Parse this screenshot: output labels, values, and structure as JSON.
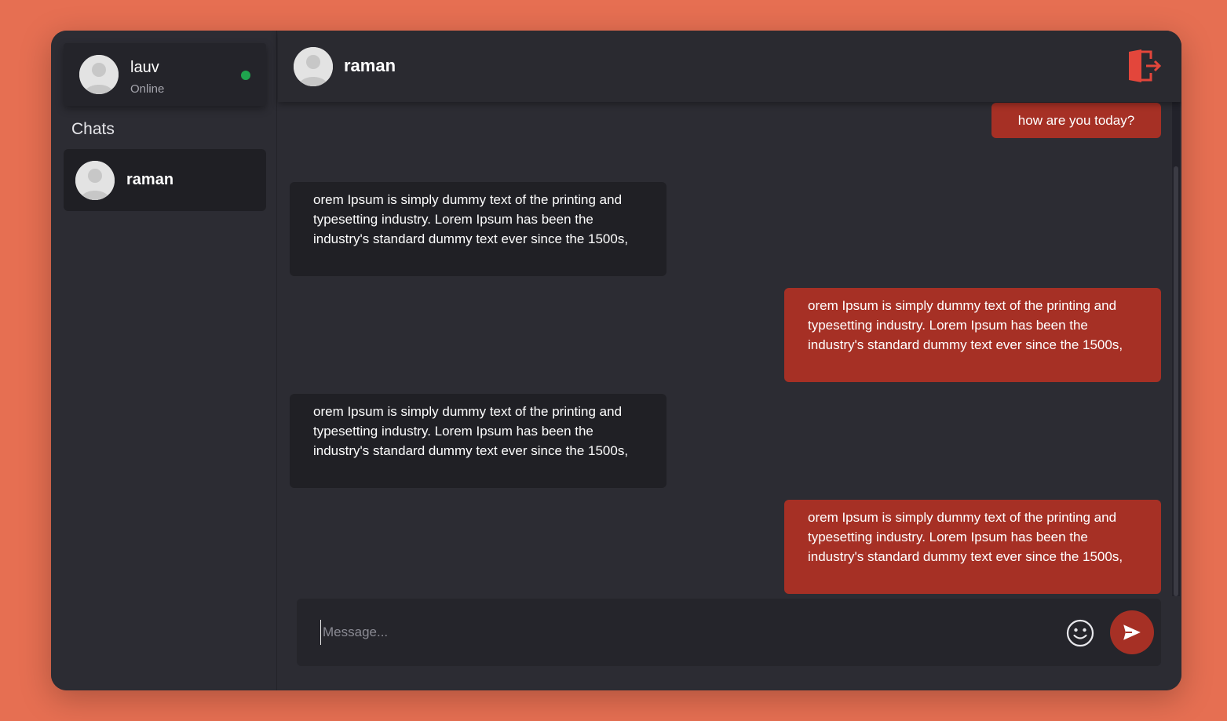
{
  "current_user": {
    "name": "lauv",
    "status": "Online"
  },
  "sidebar": {
    "heading": "Chats",
    "chats": [
      {
        "name": "raman"
      }
    ]
  },
  "conversation": {
    "contact_name": "raman",
    "messages": [
      {
        "direction": "outgoing",
        "text": "how are you today?"
      },
      {
        "direction": "incoming",
        "text": "orem Ipsum is simply dummy text of the printing and typesetting industry. Lorem Ipsum has been the industry's standard dummy text ever since the 1500s,"
      },
      {
        "direction": "outgoing",
        "text": "orem Ipsum is simply dummy text of the printing and typesetting industry. Lorem Ipsum has been the industry's standard dummy text ever since the 1500s,"
      },
      {
        "direction": "incoming",
        "text": "orem Ipsum is simply dummy text of the printing and typesetting industry. Lorem Ipsum has been the industry's standard dummy text ever since the 1500s,"
      },
      {
        "direction": "outgoing",
        "text": "orem Ipsum is simply dummy text of the printing and typesetting industry. Lorem Ipsum has been the industry's standard dummy text ever since the 1500s,"
      }
    ]
  },
  "composer": {
    "placeholder": "Message...",
    "value": ""
  },
  "icons": {
    "logout": "logout-icon",
    "emoji": "emoji-icon",
    "send": "send-icon",
    "avatar": "avatar-placeholder-icon"
  },
  "colors": {
    "background": "#e66f52",
    "panel": "#2c2c33",
    "incoming_bubble": "#202025",
    "outgoing_bubble": "#a63025",
    "online": "#1fa44e",
    "logout_icon": "#e3463b"
  }
}
